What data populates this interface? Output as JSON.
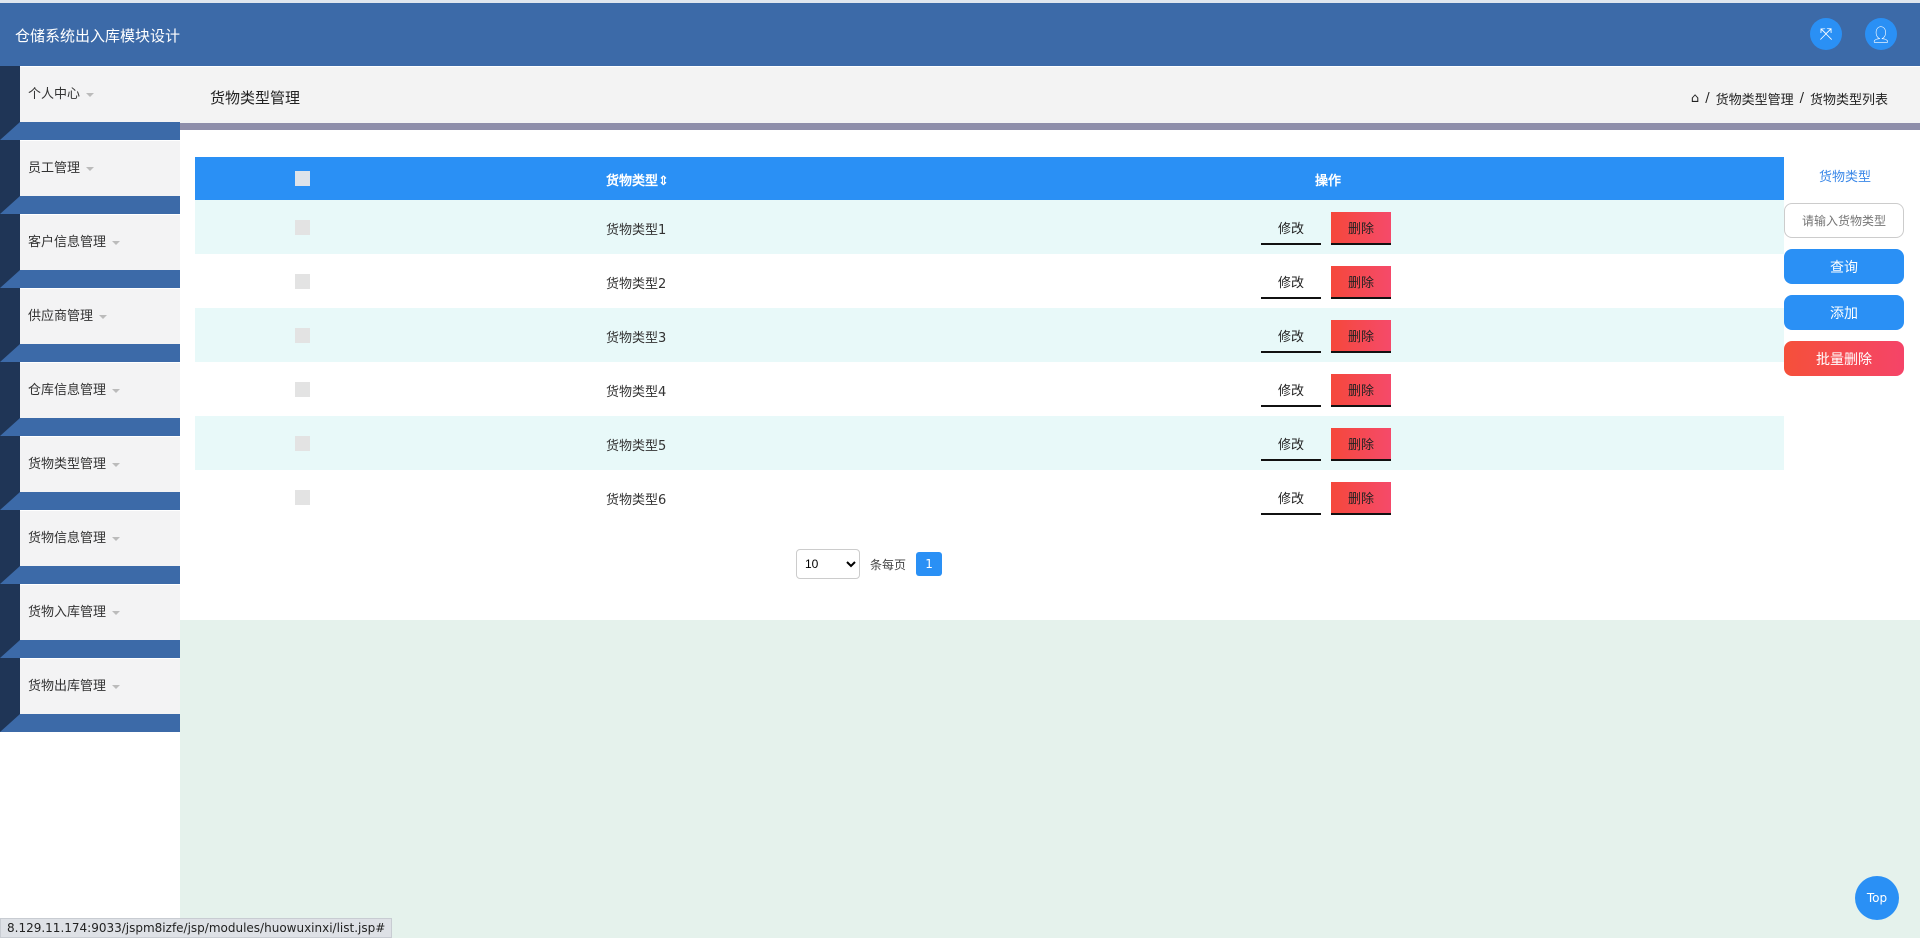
{
  "app": {
    "title": "仓储系统出入库模块设计",
    "fullscreen_icon": "expand-icon",
    "user_icon": "user-icon"
  },
  "sidebar": {
    "items": [
      {
        "label": "个人中心"
      },
      {
        "label": "员工管理"
      },
      {
        "label": "客户信息管理"
      },
      {
        "label": "供应商管理"
      },
      {
        "label": "仓库信息管理"
      },
      {
        "label": "货物类型管理"
      },
      {
        "label": "货物信息管理"
      },
      {
        "label": "货物入库管理"
      },
      {
        "label": "货物出库管理"
      }
    ]
  },
  "page": {
    "title": "货物类型管理",
    "breadcrumb": [
      "货物类型管理",
      "货物类型列表"
    ],
    "sep": "/"
  },
  "table": {
    "columns": [
      "",
      "货物类型",
      "操作"
    ],
    "sort_glyph": "⇕",
    "rows": [
      {
        "type": "货物类型1"
      },
      {
        "type": "货物类型2"
      },
      {
        "type": "货物类型3"
      },
      {
        "type": "货物类型4"
      },
      {
        "type": "货物类型5"
      },
      {
        "type": "货物类型6"
      }
    ],
    "edit_label": "修改",
    "delete_label": "删除"
  },
  "pagination": {
    "page_size": "10",
    "per_page_label": "条每页",
    "current_page": "1"
  },
  "search": {
    "label": "货物类型",
    "placeholder": "请输入货物类型",
    "query_label": "查询",
    "add_label": "添加",
    "batch_delete_label": "批量删除"
  },
  "top_button": "Top",
  "status_url": "8.129.11.174:9033/jspm8izfe/jsp/modules/huowuxinxi/list.jsp#"
}
